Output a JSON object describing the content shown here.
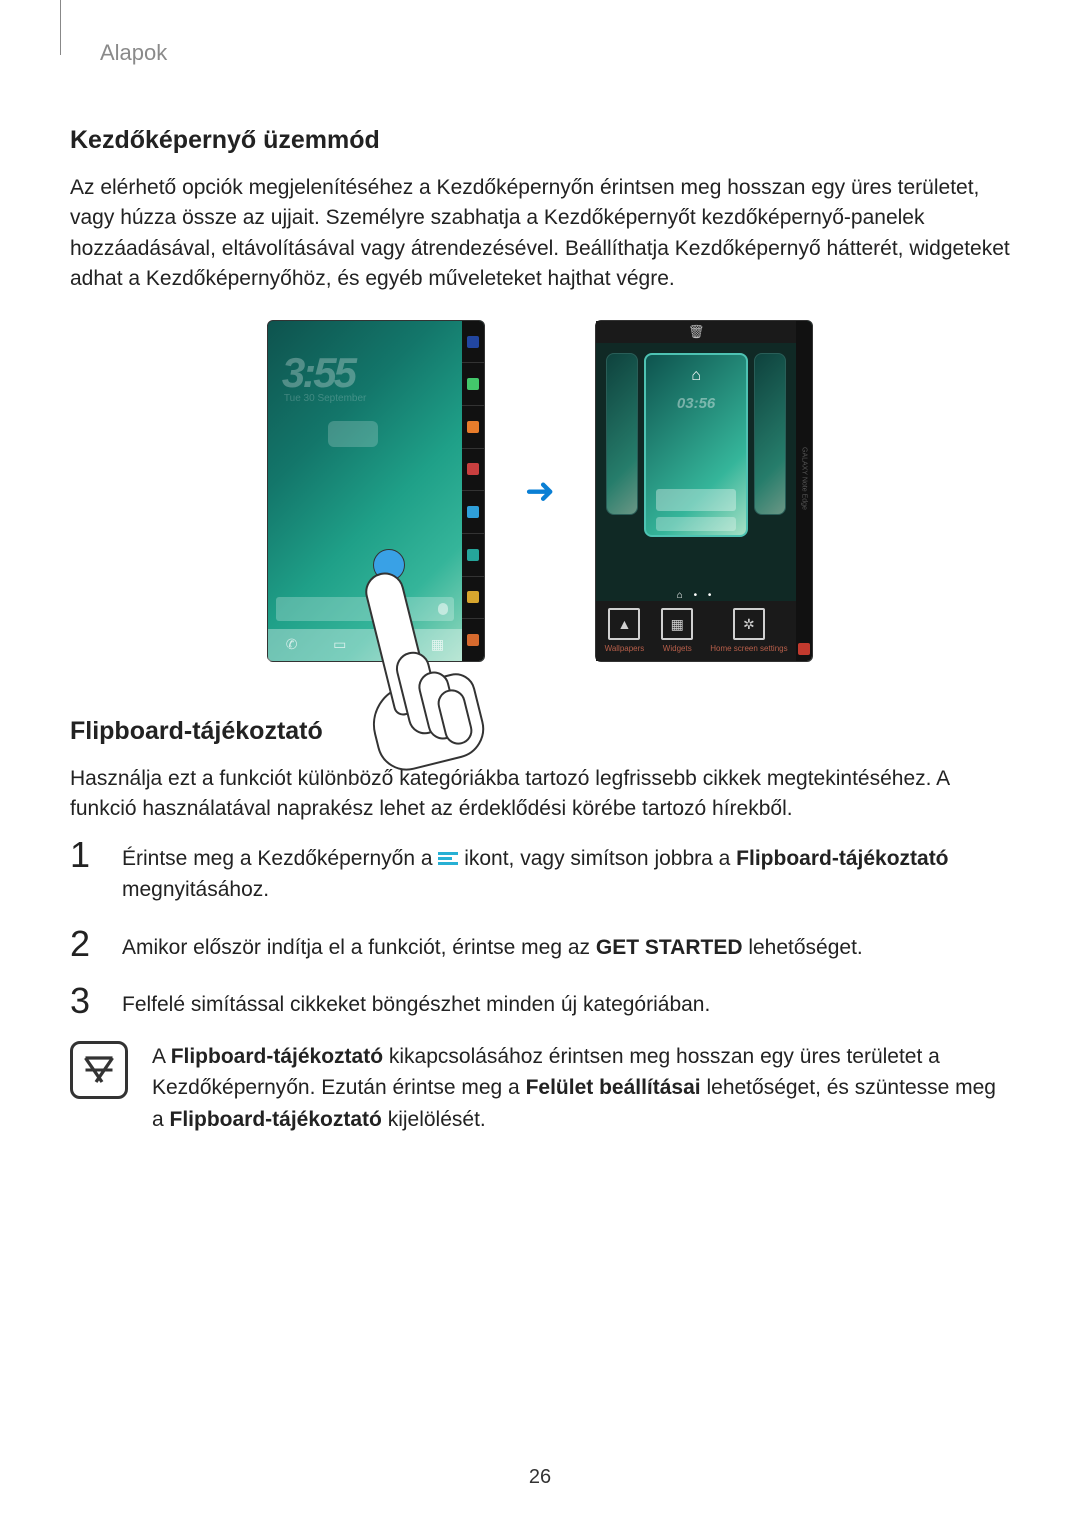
{
  "header": "Alapok",
  "section1": {
    "title": "Kezdőképernyő üzemmód",
    "para": "Az elérhető opciók megjelenítéséhez a Kezdőképernyőn érintsen meg hosszan egy üres területet, vagy húzza össze az ujjait. Személyre szabhatja a Kezdőképernyőt kezdőképernyő-panelek hozzáadásával, eltávolításával vagy átrendezésével. Beállíthatja Kezdőképernyő hátterét, widgeteket adhat a Kezdőképernyőhöz, és egyéb műveleteket hajthat végre."
  },
  "fig": {
    "phone1": {
      "clock": "3:55",
      "date": "Tue 30 September"
    },
    "phone2": {
      "trash": "🗑",
      "home": "⌂",
      "clock": "03:56",
      "opts": {
        "a": "Wallpapers",
        "b": "Widgets",
        "c": "Home screen settings"
      },
      "edge_text": "GALAXY Note Edge"
    }
  },
  "section2": {
    "title": "Flipboard-tájékoztató",
    "para": "Használja ezt a funkciót különböző kategóriákba tartozó legfrissebb cikkek megtekintéséhez. A funkció használatával naprakész lehet az érdeklődési körébe tartozó hírekből.",
    "steps": {
      "1": {
        "num": "1",
        "a": "Érintse meg a Kezdőképernyőn a ",
        "b": " ikont, vagy simítson jobbra a ",
        "bold": "Flipboard-tájékoztató",
        "c": " megnyitásához."
      },
      "2": {
        "num": "2",
        "a": "Amikor először indítja el a funkciót, érintse meg az ",
        "bold": "GET STARTED",
        "b": " lehetőséget."
      },
      "3": {
        "num": "3",
        "a": "Felfelé simítással cikkeket böngészhet minden új kategóriában."
      }
    },
    "note": {
      "a": "A ",
      "b1": "Flipboard-tájékoztató",
      "c": " kikapcsolásához érintsen meg hosszan egy üres területet a Kezdőképernyőn. Ezután érintse meg a ",
      "b2": "Felület beállításai",
      "d": " lehetőséget, és szüntesse meg a ",
      "b3": "Flipboard-tájékoztató",
      "e": " kijelölését."
    }
  },
  "page_number": "26"
}
